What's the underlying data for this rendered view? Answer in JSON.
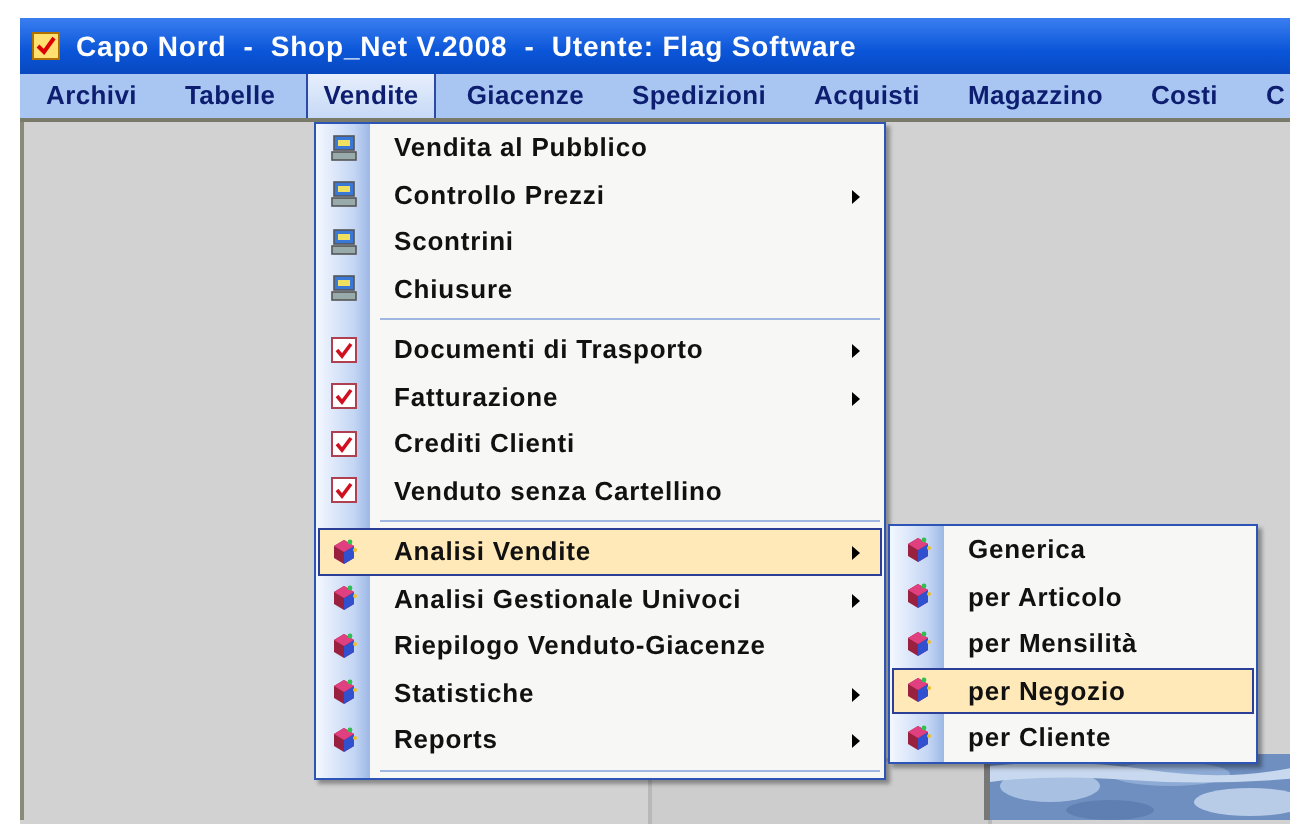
{
  "window": {
    "title": "Capo Nord  -  Shop_Net V.2008  -  Utente: Flag Software"
  },
  "menu_bar": [
    {
      "label": "Archivi",
      "selected": false
    },
    {
      "label": "Tabelle",
      "selected": false
    },
    {
      "label": "Vendite",
      "selected": true
    },
    {
      "label": "Giacenze",
      "selected": false
    },
    {
      "label": "Spedizioni",
      "selected": false
    },
    {
      "label": "Acquisti",
      "selected": false
    },
    {
      "label": "Magazzino",
      "selected": false
    },
    {
      "label": "Costi",
      "selected": false
    },
    {
      "label": "C",
      "selected": false
    }
  ],
  "dropdown": [
    {
      "kind": "pc",
      "label": "Vendita al Pubblico",
      "submenu": false,
      "selected": false
    },
    {
      "kind": "pc",
      "label": "Controllo Prezzi",
      "submenu": true,
      "selected": false
    },
    {
      "kind": "pc",
      "label": "Scontrini",
      "submenu": false,
      "selected": false
    },
    {
      "kind": "pc",
      "label": "Chiusure",
      "submenu": false,
      "selected": false
    },
    {
      "kind": "separator"
    },
    {
      "kind": "check",
      "label": "Documenti di Trasporto",
      "submenu": true,
      "selected": false
    },
    {
      "kind": "check",
      "label": "Fatturazione",
      "submenu": true,
      "selected": false
    },
    {
      "kind": "check",
      "label": "Crediti Clienti",
      "submenu": false,
      "selected": false
    },
    {
      "kind": "check",
      "label": "Venduto senza Cartellino",
      "submenu": false,
      "selected": false
    },
    {
      "kind": "separator"
    },
    {
      "kind": "cube",
      "label": "Analisi Vendite",
      "submenu": true,
      "selected": true
    },
    {
      "kind": "cube",
      "label": "Analisi Gestionale Univoci",
      "submenu": true,
      "selected": false
    },
    {
      "kind": "cube",
      "label": "Riepilogo Venduto-Giacenze",
      "submenu": false,
      "selected": false
    },
    {
      "kind": "cube",
      "label": "Statistiche",
      "submenu": true,
      "selected": false
    },
    {
      "kind": "cube",
      "label": "Reports",
      "submenu": true,
      "selected": false
    },
    {
      "kind": "separator"
    }
  ],
  "submenu": [
    {
      "kind": "cube",
      "label": "Generica",
      "selected": false
    },
    {
      "kind": "cube",
      "label": "per Articolo",
      "selected": false
    },
    {
      "kind": "cube",
      "label": "per Mensilità",
      "selected": false
    },
    {
      "kind": "cube",
      "label": "per Negozio",
      "selected": true
    },
    {
      "kind": "cube",
      "label": "per Cliente",
      "selected": false
    }
  ]
}
